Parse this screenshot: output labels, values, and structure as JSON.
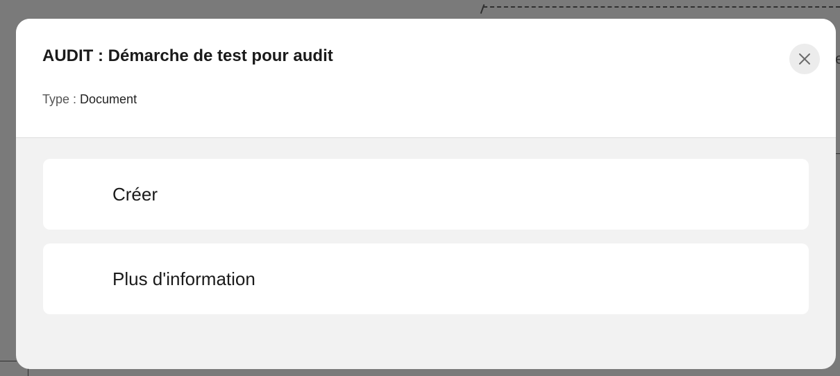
{
  "modal": {
    "title": "AUDIT : Démarche de test pour audit",
    "type_label": "Type : ",
    "type_value": "Document",
    "close_icon": "close-icon",
    "actions": [
      {
        "label": "Créer"
      },
      {
        "label": "Plus d'information"
      }
    ]
  },
  "backdrop": {
    "partial_letter": "e"
  },
  "colors": {
    "overlay": "#7a7a7a",
    "modal_body": "#f2f2f2",
    "card": "#ffffff",
    "close_button_bg": "#ececec",
    "text": "#1a1a1a"
  }
}
